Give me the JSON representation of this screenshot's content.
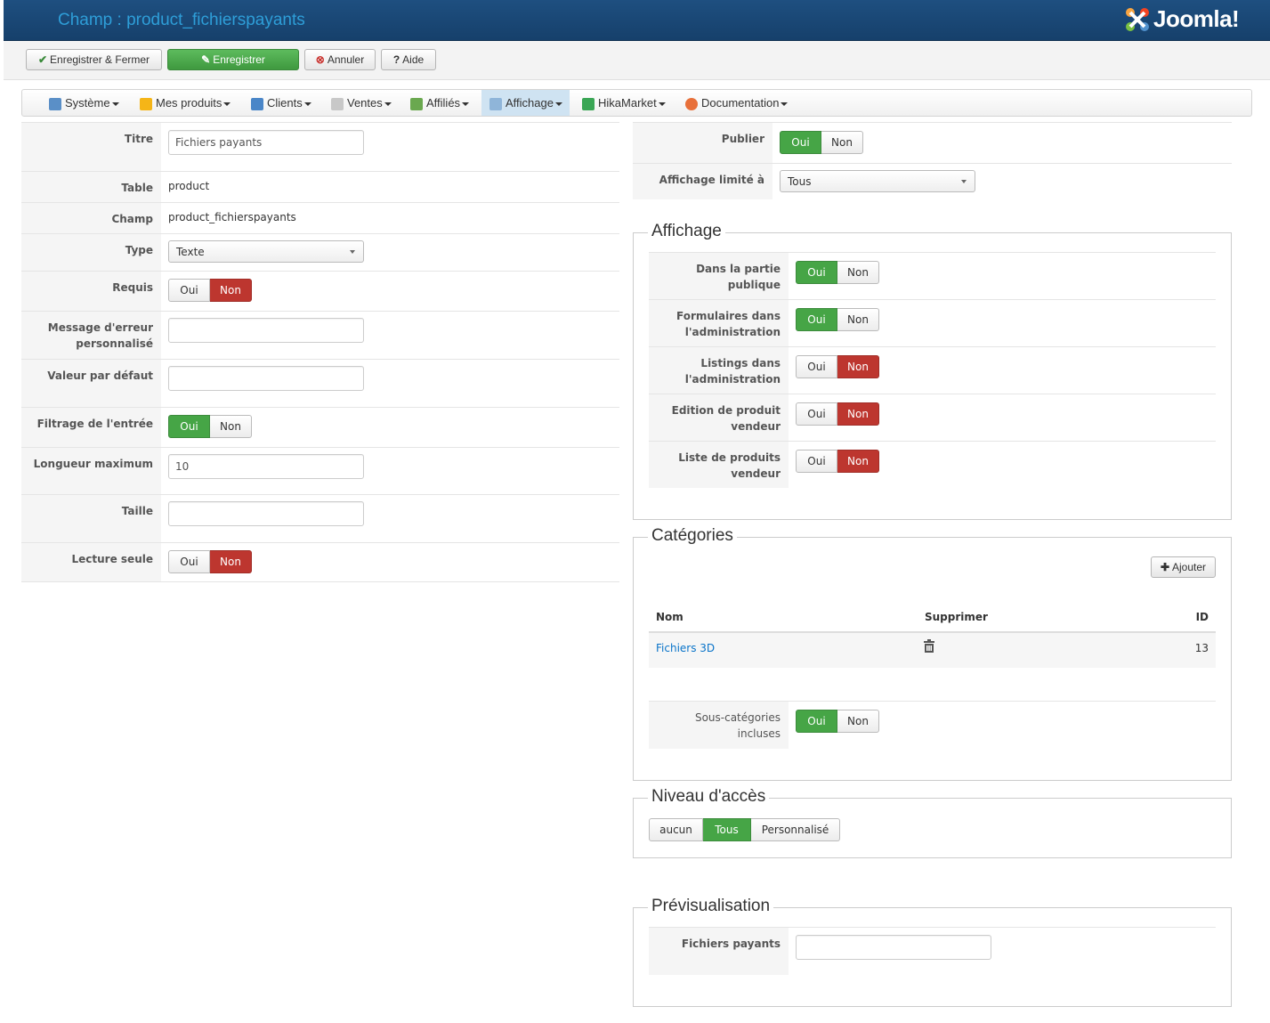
{
  "header": {
    "title": "Champ : product_fichierspayants",
    "logo_text": "Joomla!"
  },
  "toolbar": {
    "save_close": "Enregistrer & Fermer",
    "save": "Enregistrer",
    "cancel": "Annuler",
    "help": "Aide"
  },
  "menu": {
    "items": [
      {
        "label": "Système",
        "icon": "tools-icon"
      },
      {
        "label": "Mes produits",
        "icon": "products-icon"
      },
      {
        "label": "Clients",
        "icon": "users-icon"
      },
      {
        "label": "Ventes",
        "icon": "orders-icon"
      },
      {
        "label": "Affiliés",
        "icon": "affiliates-icon"
      },
      {
        "label": "Affichage",
        "icon": "display-icon"
      },
      {
        "label": "HikaMarket",
        "icon": "hikamarket-icon"
      },
      {
        "label": "Documentation",
        "icon": "help-lifebuoy-icon"
      }
    ],
    "active": "Affichage"
  },
  "left_form": {
    "titre": {
      "label": "Titre",
      "value": "Fichiers payants"
    },
    "table": {
      "label": "Table",
      "value": "product"
    },
    "champ": {
      "label": "Champ",
      "value": "product_fichierspayants"
    },
    "type": {
      "label": "Type",
      "value": "Texte"
    },
    "requis": {
      "label": "Requis",
      "yes": "Oui",
      "no": "Non",
      "selected": "Non"
    },
    "message_erreur": {
      "label_line1": "Message d'erreur",
      "label_line2": "personnalisé",
      "value": ""
    },
    "valeur_defaut": {
      "label": "Valeur par défaut",
      "value": ""
    },
    "filtrage": {
      "label": "Filtrage de l'entrée",
      "yes": "Oui",
      "no": "Non",
      "selected": "Oui"
    },
    "longueur_max": {
      "label": "Longueur maximum",
      "value": "10"
    },
    "taille": {
      "label": "Taille",
      "value": ""
    },
    "lecture_seule": {
      "label": "Lecture seule",
      "yes": "Oui",
      "no": "Non",
      "selected": "Non"
    }
  },
  "right_top": {
    "publier": {
      "label": "Publier",
      "yes": "Oui",
      "no": "Non",
      "selected": "Oui"
    },
    "affichage_limite": {
      "label": "Affichage limité à",
      "value": "Tous"
    }
  },
  "affichage": {
    "legend": "Affichage",
    "rows": [
      {
        "label_line1": "Dans la partie",
        "label_line2": "publique",
        "yes": "Oui",
        "no": "Non",
        "selected": "Oui"
      },
      {
        "label_line1": "Formulaires dans",
        "label_line2": "l'administration",
        "yes": "Oui",
        "no": "Non",
        "selected": "Oui"
      },
      {
        "label_line1": "Listings dans",
        "label_line2": "l'administration",
        "yes": "Oui",
        "no": "Non",
        "selected": "Non"
      },
      {
        "label_line1": "Edition de produit",
        "label_line2": "vendeur",
        "yes": "Oui",
        "no": "Non",
        "selected": "Non"
      },
      {
        "label_line1": "Liste de produits",
        "label_line2": "vendeur",
        "yes": "Oui",
        "no": "Non",
        "selected": "Non"
      }
    ]
  },
  "categories": {
    "legend": "Catégories",
    "add_button": "Ajouter",
    "columns": {
      "name": "Nom",
      "delete": "Supprimer",
      "id": "ID"
    },
    "rows": [
      {
        "name": "Fichiers 3D",
        "id": "13"
      }
    ],
    "sous_categories": {
      "label_line1": "Sous-catégories",
      "label_line2": "incluses",
      "yes": "Oui",
      "no": "Non",
      "selected": "Oui"
    }
  },
  "niveau_acces": {
    "legend": "Niveau d'accès",
    "options": [
      "aucun",
      "Tous",
      "Personnalisé"
    ],
    "selected": "Tous"
  },
  "previsualisation": {
    "legend": "Prévisualisation",
    "field_label": "Fichiers payants",
    "value": ""
  },
  "colors": {
    "green": "#46a546",
    "red": "#bd362f",
    "link": "#0a74c9",
    "header": "#1b4a78"
  }
}
